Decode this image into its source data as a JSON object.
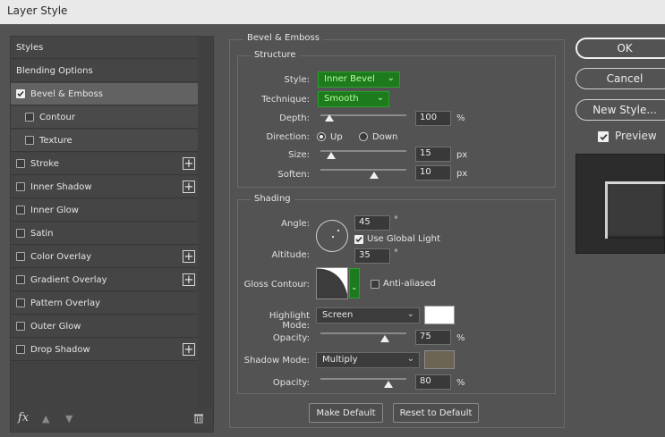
{
  "window": {
    "title": "Layer Style"
  },
  "sidebar": {
    "items": [
      {
        "label": "Styles",
        "checkbox": false,
        "plus": false,
        "sub": false,
        "selected": false
      },
      {
        "label": "Blending Options",
        "checkbox": false,
        "plus": false,
        "sub": false,
        "selected": false
      },
      {
        "label": "Bevel & Emboss",
        "checkbox": true,
        "checked": true,
        "plus": false,
        "sub": false,
        "selected": true
      },
      {
        "label": "Contour",
        "checkbox": true,
        "checked": false,
        "plus": false,
        "sub": true,
        "selected": false
      },
      {
        "label": "Texture",
        "checkbox": true,
        "checked": false,
        "plus": false,
        "sub": true,
        "selected": false
      },
      {
        "label": "Stroke",
        "checkbox": true,
        "checked": false,
        "plus": true,
        "sub": false,
        "selected": false
      },
      {
        "label": "Inner Shadow",
        "checkbox": true,
        "checked": false,
        "plus": true,
        "sub": false,
        "selected": false
      },
      {
        "label": "Inner Glow",
        "checkbox": true,
        "checked": false,
        "plus": false,
        "sub": false,
        "selected": false
      },
      {
        "label": "Satin",
        "checkbox": true,
        "checked": false,
        "plus": false,
        "sub": false,
        "selected": false
      },
      {
        "label": "Color Overlay",
        "checkbox": true,
        "checked": false,
        "plus": true,
        "sub": false,
        "selected": false
      },
      {
        "label": "Gradient Overlay",
        "checkbox": true,
        "checked": false,
        "plus": true,
        "sub": false,
        "selected": false
      },
      {
        "label": "Pattern Overlay",
        "checkbox": true,
        "checked": false,
        "plus": false,
        "sub": false,
        "selected": false
      },
      {
        "label": "Outer Glow",
        "checkbox": true,
        "checked": false,
        "plus": false,
        "sub": false,
        "selected": false
      },
      {
        "label": "Drop Shadow",
        "checkbox": true,
        "checked": false,
        "plus": true,
        "sub": false,
        "selected": false
      }
    ],
    "fx_label": "fx"
  },
  "bevel": {
    "group_title": "Bevel & Emboss",
    "structure": {
      "title": "Structure",
      "style_label": "Style:",
      "style_value": "Inner Bevel",
      "technique_label": "Technique:",
      "technique_value": "Smooth",
      "depth_label": "Depth:",
      "depth_value": "100",
      "depth_unit": "%",
      "direction_label": "Direction:",
      "direction_up": "Up",
      "direction_down": "Down",
      "size_label": "Size:",
      "size_value": "15",
      "size_unit": "px",
      "soften_label": "Soften:",
      "soften_value": "10",
      "soften_unit": "px"
    },
    "shading": {
      "title": "Shading",
      "angle_label": "Angle:",
      "angle_value": "45",
      "angle_unit": "°",
      "use_global_light": "Use Global Light",
      "altitude_label": "Altitude:",
      "altitude_value": "35",
      "altitude_unit": "°",
      "gloss_label": "Gloss Contour:",
      "anti_aliased": "Anti-aliased",
      "highlight_mode_label": "Highlight Mode:",
      "highlight_mode_value": "Screen",
      "highlight_color": "#ffffff",
      "highlight_opacity_label": "Opacity:",
      "highlight_opacity_value": "75",
      "highlight_opacity_unit": "%",
      "shadow_mode_label": "Shadow Mode:",
      "shadow_mode_value": "Multiply",
      "shadow_color": "#6b6452",
      "shadow_opacity_label": "Opacity:",
      "shadow_opacity_value": "80",
      "shadow_opacity_unit": "%"
    },
    "make_default": "Make Default",
    "reset_default": "Reset to Default"
  },
  "actions": {
    "ok": "OK",
    "cancel": "Cancel",
    "new_style": "New Style...",
    "preview": "Preview"
  },
  "colors": {
    "accent_green": "#1d7a1d",
    "panel_bg": "#535353"
  }
}
